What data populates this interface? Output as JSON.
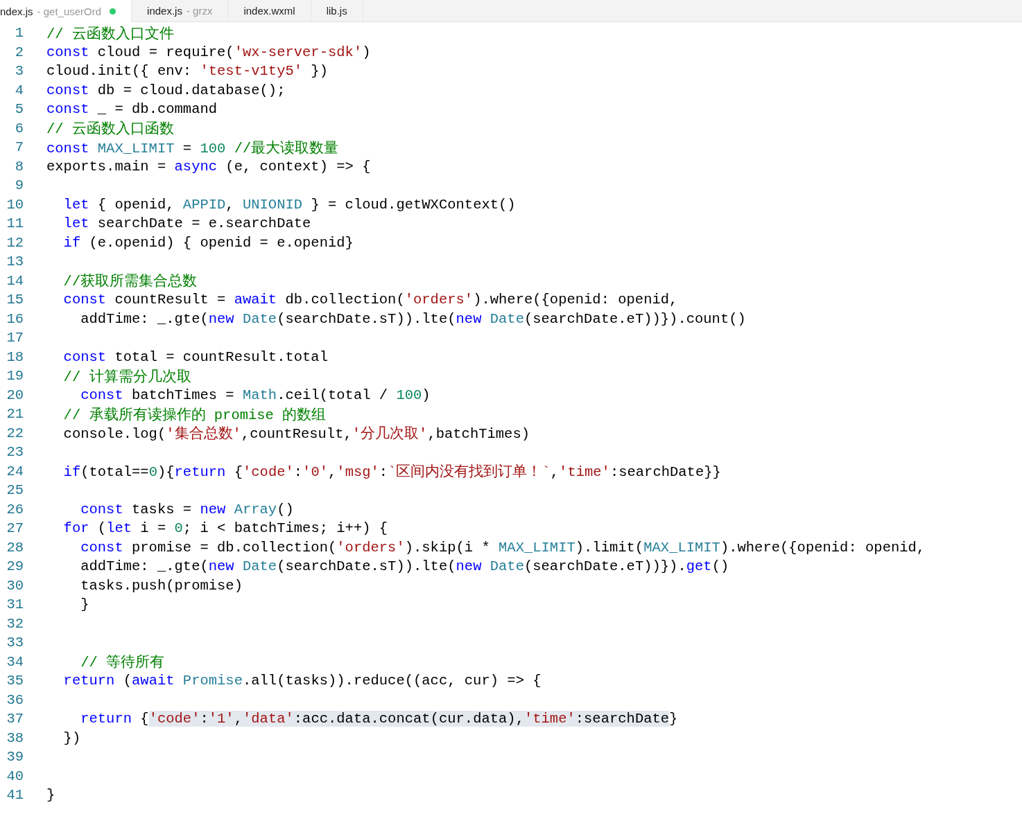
{
  "tabs": [
    {
      "label": "ndex.js",
      "detail": "- get_userOrd",
      "selected": true,
      "modified": true
    },
    {
      "label": "index.js",
      "detail": "- grzx",
      "selected": false,
      "modified": false
    },
    {
      "label": "index.wxml",
      "selected": false,
      "modified": false
    },
    {
      "label": "lib.js",
      "selected": false,
      "modified": false
    }
  ],
  "editor": {
    "lines": [
      {
        "number": "1",
        "tokens": [
          {
            "kind": "comment",
            "text": "// 云函数入口文件"
          }
        ]
      },
      {
        "number": "2",
        "tokens": [
          {
            "kind": "keyword",
            "text": "const"
          },
          {
            "kind": "plain",
            "text": " cloud = require("
          },
          {
            "kind": "string",
            "text": "'wx-server-sdk'"
          },
          {
            "kind": "plain",
            "text": ")"
          }
        ]
      },
      {
        "number": "3",
        "tokens": [
          {
            "kind": "plain",
            "text": "cloud.init({ env: "
          },
          {
            "kind": "string",
            "text": "'test-v1ty5'"
          },
          {
            "kind": "plain",
            "text": " })"
          }
        ]
      },
      {
        "number": "4",
        "tokens": [
          {
            "kind": "keyword",
            "text": "const"
          },
          {
            "kind": "plain",
            "text": " db = cloud.database();"
          }
        ]
      },
      {
        "number": "5",
        "tokens": [
          {
            "kind": "keyword",
            "text": "const"
          },
          {
            "kind": "plain",
            "text": " _ = db.command"
          }
        ]
      },
      {
        "number": "6",
        "tokens": [
          {
            "kind": "comment",
            "text": "// 云函数入口函数"
          }
        ]
      },
      {
        "number": "7",
        "tokens": [
          {
            "kind": "keyword",
            "text": "const "
          },
          {
            "kind": "type",
            "text": "MAX_LIMIT"
          },
          {
            "kind": "plain",
            "text": " = "
          },
          {
            "kind": "number",
            "text": "100 "
          },
          {
            "kind": "comment",
            "text": "//最大读取数量"
          }
        ]
      },
      {
        "number": "8",
        "tokens": [
          {
            "kind": "plain",
            "text": "exports.main = "
          },
          {
            "kind": "keyword",
            "text": "async"
          },
          {
            "kind": "plain",
            "text": " (e, context) => {"
          }
        ]
      },
      {
        "number": "9"
      },
      {
        "number": "10",
        "tokens": [
          {
            "kind": "keyword",
            "text": "  let"
          },
          {
            "kind": "plain",
            "text": " { openid, "
          },
          {
            "kind": "type",
            "text": "APPID"
          },
          {
            "kind": "plain",
            "text": ", "
          },
          {
            "kind": "type",
            "text": "UNIONID"
          },
          {
            "kind": "plain",
            "text": " } = cloud.getWXContext()"
          }
        ]
      },
      {
        "number": "11",
        "tokens": [
          {
            "kind": "keyword",
            "text": "  let"
          },
          {
            "kind": "plain",
            "text": " searchDate = e.searchDate"
          }
        ]
      },
      {
        "number": "12",
        "tokens": [
          {
            "kind": "keyword",
            "text": "  if"
          },
          {
            "kind": "plain",
            "text": " (e.openid) { openid = e.openid}"
          }
        ]
      },
      {
        "number": "13"
      },
      {
        "number": "14",
        "tokens": [
          {
            "kind": "comment",
            "text": "  //获取所需集合总数"
          }
        ]
      },
      {
        "number": "15",
        "tokens": [
          {
            "kind": "keyword",
            "text": "  const"
          },
          {
            "kind": "plain",
            "text": " countResult = "
          },
          {
            "kind": "keyword",
            "text": "await"
          },
          {
            "kind": "plain",
            "text": " db.collection("
          },
          {
            "kind": "string",
            "text": "'orders'"
          },
          {
            "kind": "plain",
            "text": ").where({openid: openid,"
          }
        ]
      },
      {
        "number": "16",
        "tokens": [
          {
            "kind": "plain",
            "text": "    addTime: _.gte("
          },
          {
            "kind": "keyword",
            "text": "new "
          },
          {
            "kind": "type",
            "text": "Date"
          },
          {
            "kind": "plain",
            "text": "(searchDate.sT)).lte("
          },
          {
            "kind": "keyword",
            "text": "new "
          },
          {
            "kind": "type",
            "text": "Date"
          },
          {
            "kind": "plain",
            "text": "(searchDate.eT))}).count()"
          }
        ]
      },
      {
        "number": "17"
      },
      {
        "number": "18",
        "tokens": [
          {
            "kind": "keyword",
            "text": "  const"
          },
          {
            "kind": "plain",
            "text": " total = countResult.total"
          }
        ]
      },
      {
        "number": "19",
        "tokens": [
          {
            "kind": "comment",
            "text": "  // 计算需分几次取"
          }
        ]
      },
      {
        "number": "20",
        "tokens": [
          {
            "kind": "keyword",
            "text": "    const"
          },
          {
            "kind": "plain",
            "text": " batchTimes = "
          },
          {
            "kind": "type",
            "text": "Math"
          },
          {
            "kind": "plain",
            "text": ".ceil(total / "
          },
          {
            "kind": "number",
            "text": "100"
          },
          {
            "kind": "plain",
            "text": ")"
          }
        ]
      },
      {
        "number": "21",
        "tokens": [
          {
            "kind": "comment",
            "text": "  // 承载所有读操作的 promise 的数组"
          }
        ]
      },
      {
        "number": "22",
        "tokens": [
          {
            "kind": "plain",
            "text": "  console.log("
          },
          {
            "kind": "string",
            "text": "'集合总数'"
          },
          {
            "kind": "plain",
            "text": ",countResult,"
          },
          {
            "kind": "string",
            "text": "'分几次取'"
          },
          {
            "kind": "plain",
            "text": ",batchTimes)"
          }
        ]
      },
      {
        "number": "23"
      },
      {
        "number": "24",
        "tokens": [
          {
            "kind": "keyword",
            "text": "  if"
          },
          {
            "kind": "plain",
            "text": "(total=="
          },
          {
            "kind": "number",
            "text": "0"
          },
          {
            "kind": "plain",
            "text": "){"
          },
          {
            "kind": "keyword",
            "text": "return"
          },
          {
            "kind": "plain",
            "text": " {"
          },
          {
            "kind": "string",
            "text": "'code'"
          },
          {
            "kind": "plain",
            "text": ":"
          },
          {
            "kind": "string",
            "text": "'0'"
          },
          {
            "kind": "plain",
            "text": ","
          },
          {
            "kind": "string",
            "text": "'msg'"
          },
          {
            "kind": "plain",
            "text": ":"
          },
          {
            "kind": "string",
            "text": "`区间内没有找到订单！`"
          },
          {
            "kind": "plain",
            "text": ","
          },
          {
            "kind": "string",
            "text": "'time'"
          },
          {
            "kind": "plain",
            "text": ":searchDate}}"
          }
        ]
      },
      {
        "number": "25"
      },
      {
        "number": "26",
        "tokens": [
          {
            "kind": "keyword",
            "text": "    const"
          },
          {
            "kind": "plain",
            "text": " tasks = "
          },
          {
            "kind": "keyword",
            "text": "new "
          },
          {
            "kind": "type",
            "text": "Array"
          },
          {
            "kind": "plain",
            "text": "()"
          }
        ]
      },
      {
        "number": "27",
        "tokens": [
          {
            "kind": "keyword",
            "text": "  for"
          },
          {
            "kind": "plain",
            "text": " ("
          },
          {
            "kind": "keyword",
            "text": "let"
          },
          {
            "kind": "plain",
            "text": " i = "
          },
          {
            "kind": "number",
            "text": "0"
          },
          {
            "kind": "plain",
            "text": "; i < batchTimes; i++) {"
          }
        ]
      },
      {
        "number": "28",
        "tokens": [
          {
            "kind": "keyword",
            "text": "    const"
          },
          {
            "kind": "plain",
            "text": " promise = db.collection("
          },
          {
            "kind": "string",
            "text": "'orders'"
          },
          {
            "kind": "plain",
            "text": ").skip(i * "
          },
          {
            "kind": "type",
            "text": "MAX_LIMIT"
          },
          {
            "kind": "plain",
            "text": ").limit("
          },
          {
            "kind": "type",
            "text": "MAX_LIMIT"
          },
          {
            "kind": "plain",
            "text": ").where({openid: openid,"
          }
        ]
      },
      {
        "number": "29",
        "tokens": [
          {
            "kind": "plain",
            "text": "    addTime: _.gte("
          },
          {
            "kind": "keyword",
            "text": "new "
          },
          {
            "kind": "type",
            "text": "Date"
          },
          {
            "kind": "plain",
            "text": "(searchDate.sT)).lte("
          },
          {
            "kind": "keyword",
            "text": "new "
          },
          {
            "kind": "type",
            "text": "Date"
          },
          {
            "kind": "plain",
            "text": "(searchDate.eT))})."
          },
          {
            "kind": "keyword",
            "text": "get"
          },
          {
            "kind": "plain",
            "text": "()"
          }
        ]
      },
      {
        "number": "30",
        "tokens": [
          {
            "kind": "plain",
            "text": "    tasks.push(promise)"
          }
        ]
      },
      {
        "number": "31",
        "tokens": [
          {
            "kind": "plain",
            "text": "    }"
          }
        ]
      },
      {
        "number": "32"
      },
      {
        "number": "33"
      },
      {
        "number": "34",
        "tokens": [
          {
            "kind": "comment",
            "text": "    // 等待所有"
          }
        ]
      },
      {
        "number": "35",
        "tokens": [
          {
            "kind": "keyword",
            "text": "  return"
          },
          {
            "kind": "plain",
            "text": " ("
          },
          {
            "kind": "keyword",
            "text": "await "
          },
          {
            "kind": "type",
            "text": "Promise"
          },
          {
            "kind": "plain",
            "text": ".all(tasks)).reduce((acc, cur) => {"
          }
        ]
      },
      {
        "number": "36"
      },
      {
        "number": "37",
        "tokens": [
          {
            "kind": "keyword",
            "text": "    return"
          },
          {
            "kind": "plain",
            "text": " {"
          },
          {
            "kind": "hlstring",
            "text": "'code'"
          },
          {
            "kind": "hlplain",
            "text": ":"
          },
          {
            "kind": "hlstring",
            "text": "'1'"
          },
          {
            "kind": "hlplain",
            "text": ","
          },
          {
            "kind": "hlstring",
            "text": "'data'"
          },
          {
            "kind": "hlplain",
            "text": ":acc.data.concat(cur.data),"
          },
          {
            "kind": "hlstring",
            "text": "'time'"
          },
          {
            "kind": "hlplain",
            "text": ":searchDate"
          },
          {
            "kind": "plain",
            "text": "}"
          }
        ]
      },
      {
        "number": "38",
        "tokens": [
          {
            "kind": "plain",
            "text": "  })"
          }
        ]
      },
      {
        "number": "39"
      },
      {
        "number": "40"
      },
      {
        "number": "41",
        "tokens": [
          {
            "kind": "plain",
            "text": "}"
          }
        ]
      }
    ]
  }
}
